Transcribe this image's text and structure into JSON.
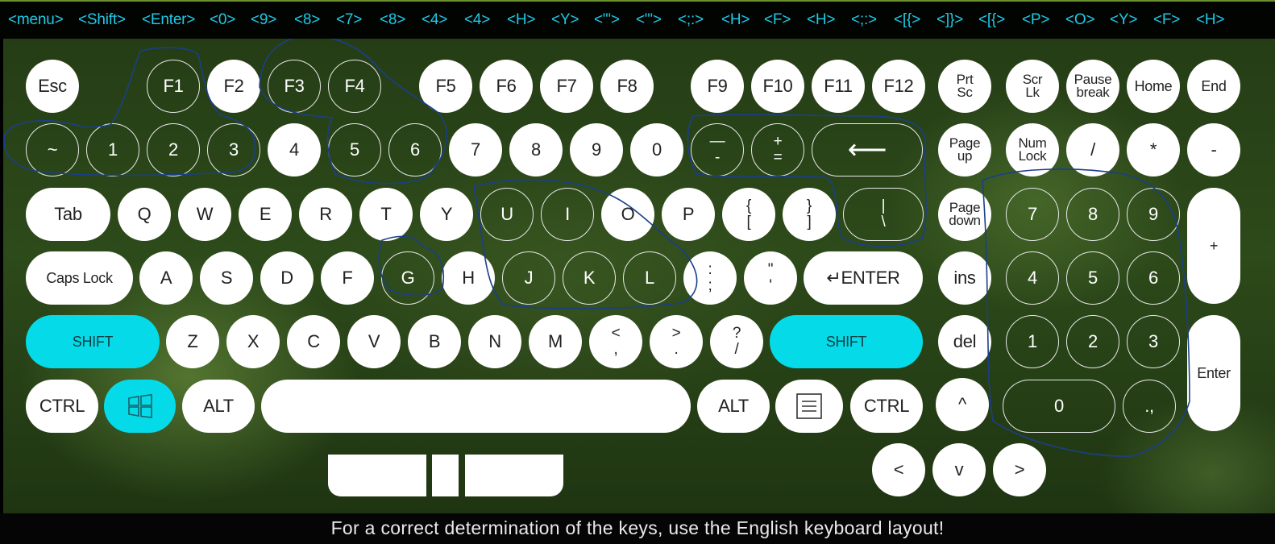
{
  "key_log": [
    "<menu>",
    "<Shift>",
    "<Enter>",
    "<0>",
    "<9>",
    "<8>",
    "<7>",
    "<8>",
    "<4>",
    "<4>",
    "<H>",
    "<Y>",
    "<\"'>",
    "<\"'>",
    "<;:>",
    "<H>",
    "<F>",
    "<H>",
    "<;:>",
    "<[{>",
    "<]}>",
    "<[{>",
    "<P>",
    "<O>",
    "<Y>",
    "<F>",
    "<H>"
  ],
  "colors": {
    "accent": "#05dbe8",
    "key_bg": "#ffffff",
    "annotation": "#1a3f8a",
    "log_text": "#1fc9e6"
  },
  "keys": {
    "esc": "Esc",
    "f1": "F1",
    "f2": "F2",
    "f3": "F3",
    "f4": "F4",
    "f5": "F5",
    "f6": "F6",
    "f7": "F7",
    "f8": "F8",
    "f9": "F9",
    "f10": "F10",
    "f11": "F11",
    "f12": "F12",
    "prtsc": "Prt\nSc",
    "scrlk": "Scr\nLk",
    "pause": "Pause\nbreak",
    "home": "Home",
    "end": "End",
    "tilde": "~",
    "n1": "1",
    "n2": "2",
    "n3": "3",
    "n4": "4",
    "n5": "5",
    "n6": "6",
    "n7": "7",
    "n8": "8",
    "n9": "9",
    "n0": "0",
    "minus": "—\n-",
    "plus": "+\n=",
    "backspace": "⟵",
    "pageup": "Page\nup",
    "numlock": "Num\nLock",
    "np_div": "/",
    "np_mul": "*",
    "np_minus": "-",
    "tab": "Tab",
    "q": "Q",
    "w": "W",
    "e": "E",
    "r": "R",
    "t": "T",
    "y": "Y",
    "u": "U",
    "i": "I",
    "o": "O",
    "p": "P",
    "lbrace": "{\n[",
    "rbrace": "}\n]",
    "pipe": "|\n\\",
    "pagedown": "Page\ndown",
    "np7": "7",
    "np8": "8",
    "np9": "9",
    "np_plus": "+",
    "caps": "Caps Lock",
    "a": "A",
    "s": "S",
    "d": "D",
    "f": "F",
    "g": "G",
    "h": "H",
    "j": "J",
    "k": "K",
    "l": "L",
    "semicolon": ":\n;",
    "quote": "\"\n'",
    "enter": "↵ENTER",
    "ins": "ins",
    "np4": "4",
    "np5": "5",
    "np6": "6",
    "shift_l": "SHIFT",
    "z": "Z",
    "x": "X",
    "c": "C",
    "v": "V",
    "b": "B",
    "n": "N",
    "m": "M",
    "comma": "<\n,",
    "period": ">\n.",
    "slash": "?\n/",
    "shift_r": "SHIFT",
    "del": "del",
    "np1": "1",
    "np2": "2",
    "np3": "3",
    "np_enter": "Enter",
    "ctrl_l": "CTRL",
    "alt_l": "ALT",
    "space": "",
    "alt_r": "ALT",
    "ctrl_r": "CTRL",
    "up": "^",
    "np0": "0",
    "np_dot": ".,",
    "left": "<",
    "down": "v",
    "right": ">"
  },
  "footer": "For a correct determination of the keys, use the English keyboard layout!"
}
